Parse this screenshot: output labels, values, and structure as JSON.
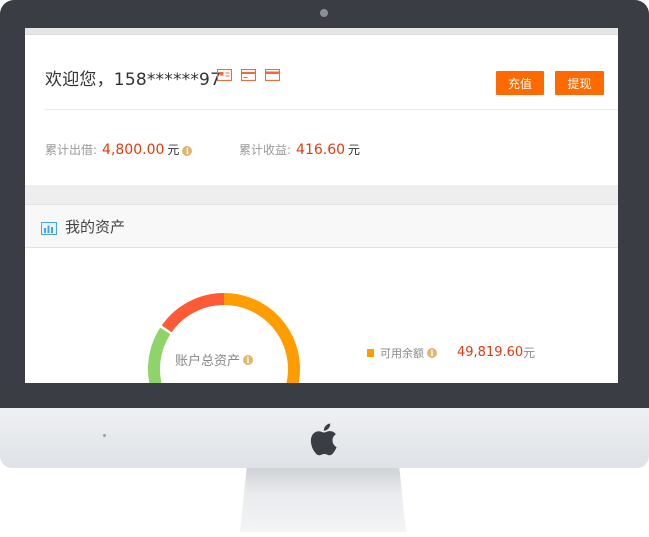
{
  "account": {
    "welcome": "欢迎您，158******97",
    "recharge_label": "充值",
    "withdraw_label": "提现"
  },
  "stats": {
    "lent_label": "累计出借:",
    "lent_value": "4,800.00",
    "lent_unit": "元",
    "earnings_label": "累计收益:",
    "earnings_value": "416.60",
    "earnings_unit": "元",
    "info_glyph": "i"
  },
  "assets": {
    "title": "我的资产",
    "donut_label": "账户总资产",
    "legend": [
      {
        "label": "可用余额",
        "value": "49,819.60",
        "unit": "元",
        "color": "#ff9c00"
      }
    ],
    "ring_colors": {
      "orange": "#ff9c00",
      "red": "#ff5a36",
      "green": "#8ed46a"
    }
  },
  "colors": {
    "accent": "#ff6a00",
    "value_red": "#e8380d",
    "bezel": "#3a3d44"
  }
}
